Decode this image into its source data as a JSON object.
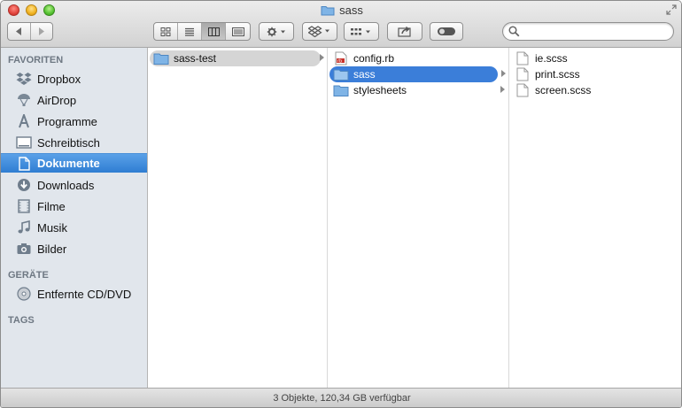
{
  "window": {
    "title": "sass"
  },
  "toolbar": {
    "search": {
      "value": "",
      "placeholder": ""
    }
  },
  "sidebar": {
    "favorites_header": "FAVORITEN",
    "favorites": [
      {
        "label": "Dropbox",
        "icon": "dropbox-icon"
      },
      {
        "label": "AirDrop",
        "icon": "airdrop-icon"
      },
      {
        "label": "Programme",
        "icon": "applications-icon"
      },
      {
        "label": "Schreibtisch",
        "icon": "desktop-icon"
      },
      {
        "label": "Dokumente",
        "icon": "documents-icon",
        "selected": true
      },
      {
        "label": "Downloads",
        "icon": "downloads-icon"
      },
      {
        "label": "Filme",
        "icon": "movies-icon"
      },
      {
        "label": "Musik",
        "icon": "music-icon"
      },
      {
        "label": "Bilder",
        "icon": "pictures-icon"
      }
    ],
    "devices_header": "GERÄTE",
    "devices": [
      {
        "label": "Entfernte CD/DVD",
        "icon": "remote-disc-icon"
      }
    ],
    "tags_header": "TAGS"
  },
  "columns": [
    {
      "items": [
        {
          "name": "sass-test",
          "type": "folder",
          "state": "open"
        }
      ]
    },
    {
      "items": [
        {
          "name": "config.rb",
          "type": "ruby-file"
        },
        {
          "name": "sass",
          "type": "folder",
          "state": "selected"
        },
        {
          "name": "stylesheets",
          "type": "folder"
        }
      ]
    },
    {
      "items": [
        {
          "name": "ie.scss",
          "type": "file"
        },
        {
          "name": "print.scss",
          "type": "file"
        },
        {
          "name": "screen.scss",
          "type": "file"
        }
      ]
    }
  ],
  "status": {
    "text": "3 Objekte, 120,34 GB verfügbar"
  },
  "colors": {
    "selection": "#3b7ed9",
    "sidebar_selection": "#2f7dd2",
    "sidebar_bg": "#e1e6ec",
    "folder": "#7fb4e6"
  }
}
